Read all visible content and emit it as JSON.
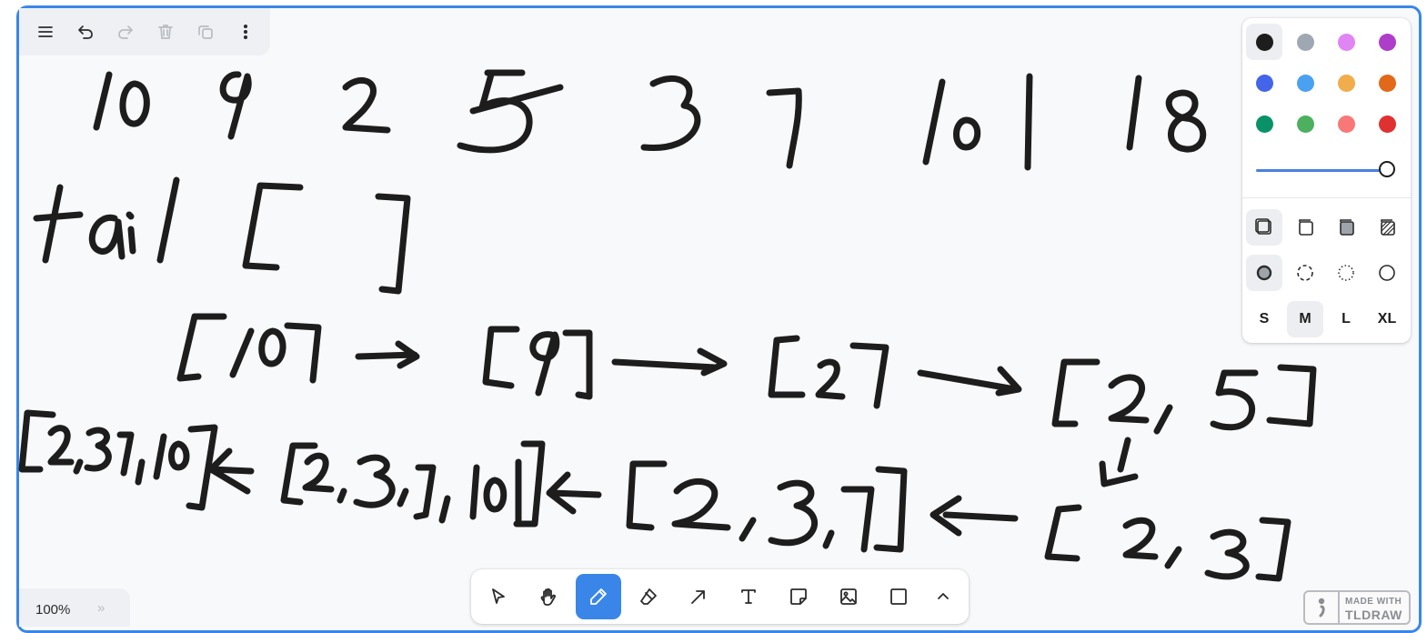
{
  "app": {
    "name": "tldraw"
  },
  "menu": {
    "main_menu_icon": "hamburger-icon",
    "undo_icon": "undo-icon",
    "redo_icon": "redo-icon",
    "delete_icon": "trash-icon",
    "duplicate_icon": "duplicate-icon",
    "more_icon": "more-vertical-icon"
  },
  "style_panel": {
    "colors": [
      {
        "name": "black",
        "hex": "#1d1d1d",
        "selected": true
      },
      {
        "name": "grey",
        "hex": "#9fa8b2"
      },
      {
        "name": "light-violet",
        "hex": "#e085f4"
      },
      {
        "name": "violet",
        "hex": "#ae3ec9"
      },
      {
        "name": "blue",
        "hex": "#4465e9"
      },
      {
        "name": "light-blue",
        "hex": "#4ba1f1"
      },
      {
        "name": "yellow",
        "hex": "#f1ac4b"
      },
      {
        "name": "orange",
        "hex": "#e16919"
      },
      {
        "name": "green",
        "hex": "#099268"
      },
      {
        "name": "light-green",
        "hex": "#4cb05e"
      },
      {
        "name": "light-red",
        "hex": "#f87777"
      },
      {
        "name": "red",
        "hex": "#e03131"
      }
    ],
    "opacity": 1.0,
    "fill_options": [
      "fill-none-icon",
      "fill-semi-icon",
      "fill-solid-icon",
      "fill-pattern-icon"
    ],
    "dash_options": [
      "dash-draw-icon",
      "dash-dashed-icon",
      "dash-dotted-icon",
      "dash-solid-icon"
    ],
    "sizes": [
      "S",
      "M",
      "L",
      "XL"
    ],
    "selected_size": "M"
  },
  "toolbar": {
    "tools": [
      "select-icon",
      "hand-icon",
      "draw-icon",
      "eraser-icon",
      "arrow-icon",
      "text-icon",
      "note-icon",
      "image-icon",
      "rectangle-icon",
      "chevron-up-icon"
    ],
    "active_tool": "draw-icon"
  },
  "zoom": {
    "level": "100%",
    "minimap_toggle": "»"
  },
  "watermark": {
    "line1": "MADE WITH",
    "line2": "TLDRAW"
  },
  "accent_color": "#3a86e8"
}
